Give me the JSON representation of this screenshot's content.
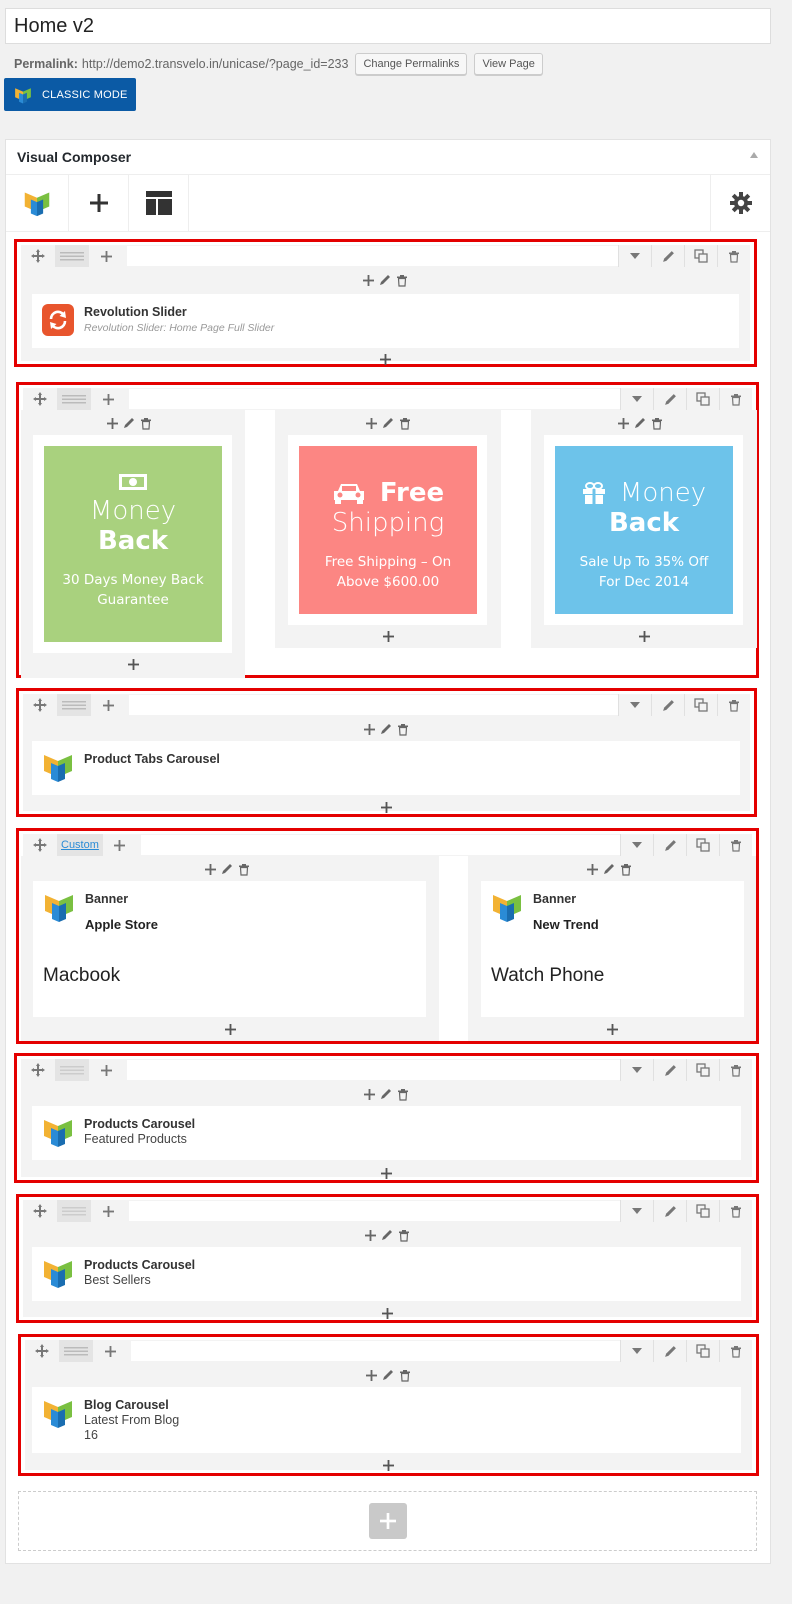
{
  "page_title": "Home v2",
  "permalink": {
    "label": "Permalink:",
    "url": "http://demo2.transvelo.in/unicase/?page_id=233",
    "change_btn": "Change Permalinks",
    "view_btn": "View Page"
  },
  "classic_mode": "CLASSIC MODE",
  "vc": {
    "title": "Visual Composer",
    "icons": {
      "logo": "vc-logo-icon",
      "add": "plus-icon",
      "templates": "layout-icon",
      "settings": "gear-icon"
    }
  },
  "rows": {
    "r1": {
      "title": "Revolution Slider",
      "subtitle": "Revolution Slider: Home Page Full Slider"
    },
    "r2": {
      "b1": {
        "line1": "Money",
        "line2": "Back",
        "line3": "30 Days Money Back",
        "line4": "Guarantee",
        "color": "#a9d17e"
      },
      "b2": {
        "line1": "Free",
        "line2": "Shipping",
        "line3": "Free Shipping – On",
        "line4": "Above $600.00",
        "color": "#fc8683"
      },
      "b3": {
        "line1": "Money",
        "line2": "Back",
        "line3": "Sale Up To 35% Off",
        "line4": "For Dec 2014",
        "color": "#6dc3ea"
      }
    },
    "r3": {
      "title": "Product Tabs Carousel"
    },
    "r4": {
      "custom": "Custom",
      "left": {
        "title": "Banner",
        "subtitle": "Apple Store",
        "text": "Macbook"
      },
      "right": {
        "title": "Banner",
        "subtitle": "New Trend",
        "text": "Watch Phone"
      }
    },
    "r5": {
      "title": "Products Carousel",
      "subtitle": "Featured Products"
    },
    "r6": {
      "title": "Products Carousel",
      "subtitle": "Best Sellers"
    },
    "r7": {
      "title": "Blog Carousel",
      "subtitle": "Latest From Blog",
      "count": "16"
    }
  },
  "colors": {
    "outline": "#e40000",
    "classic_btn": "#0b5aa5"
  }
}
